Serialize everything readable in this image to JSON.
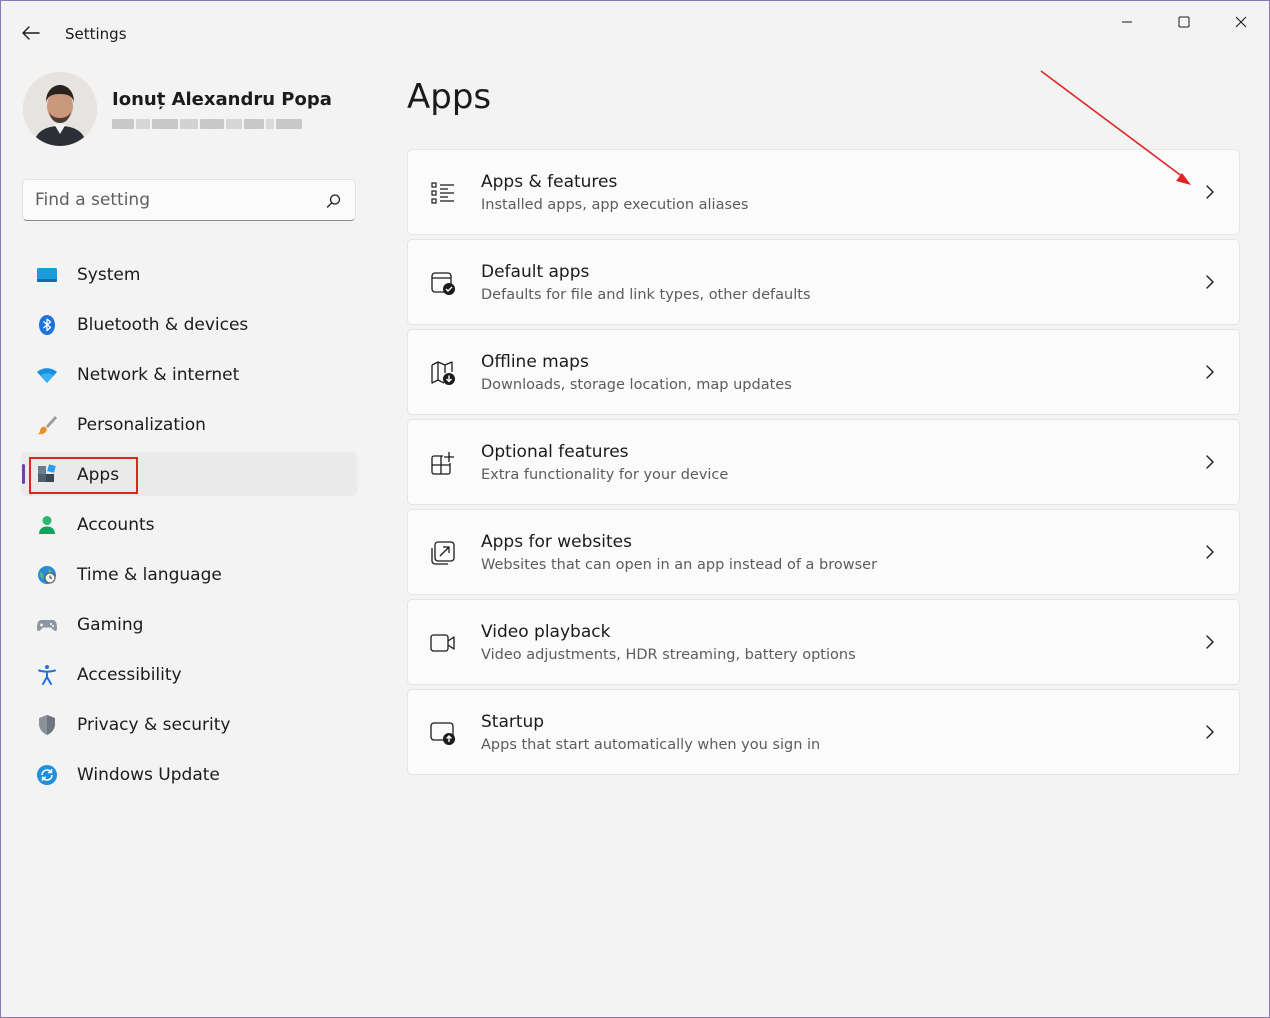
{
  "window": {
    "title": "Settings"
  },
  "profile": {
    "name": "Ionuț Alexandru Popa"
  },
  "search": {
    "placeholder": "Find a setting"
  },
  "nav": {
    "items": [
      {
        "label": "System",
        "icon": "system-icon"
      },
      {
        "label": "Bluetooth & devices",
        "icon": "bluetooth-icon"
      },
      {
        "label": "Network & internet",
        "icon": "wifi-icon"
      },
      {
        "label": "Personalization",
        "icon": "brush-icon"
      },
      {
        "label": "Apps",
        "icon": "apps-icon",
        "active": true
      },
      {
        "label": "Accounts",
        "icon": "account-icon"
      },
      {
        "label": "Time & language",
        "icon": "globe-clock-icon"
      },
      {
        "label": "Gaming",
        "icon": "gamepad-icon"
      },
      {
        "label": "Accessibility",
        "icon": "accessibility-icon"
      },
      {
        "label": "Privacy & security",
        "icon": "shield-icon"
      },
      {
        "label": "Windows Update",
        "icon": "update-icon"
      }
    ]
  },
  "main": {
    "title": "Apps",
    "cards": [
      {
        "title": "Apps & features",
        "subtitle": "Installed apps, app execution aliases",
        "icon": "list-icon"
      },
      {
        "title": "Default apps",
        "subtitle": "Defaults for file and link types, other defaults",
        "icon": "default-apps-icon"
      },
      {
        "title": "Offline maps",
        "subtitle": "Downloads, storage location, map updates",
        "icon": "map-download-icon"
      },
      {
        "title": "Optional features",
        "subtitle": "Extra functionality for your device",
        "icon": "add-grid-icon"
      },
      {
        "title": "Apps for websites",
        "subtitle": "Websites that can open in an app instead of a browser",
        "icon": "open-external-icon"
      },
      {
        "title": "Video playback",
        "subtitle": "Video adjustments, HDR streaming, battery options",
        "icon": "video-camera-icon"
      },
      {
        "title": "Startup",
        "subtitle": "Apps that start automatically when you sign in",
        "icon": "startup-icon"
      }
    ]
  },
  "colors": {
    "accent": "#6f3fb5",
    "annotation_red": "#e02424"
  }
}
